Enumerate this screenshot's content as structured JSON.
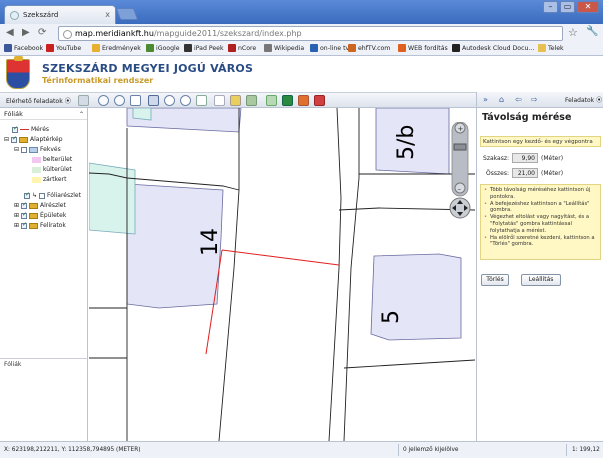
{
  "browser": {
    "tab_title": "Szekszárd",
    "tab_close": "x",
    "address_host": "map.meridiankft.hu",
    "address_path": "/mapguide2011/szekszard/index.php",
    "bookmarks": [
      {
        "label": "Facebook",
        "color": "#3b5998"
      },
      {
        "label": "YouTube",
        "color": "#cc2020"
      },
      {
        "label": "Eredmények",
        "color": "#e8b030"
      },
      {
        "label": "iGoogle",
        "color": "#4a8a30"
      },
      {
        "label": "iPad Peek",
        "color": "#333333"
      },
      {
        "label": "nCore",
        "color": "#b02020"
      },
      {
        "label": "Wikipedia",
        "color": "#777777"
      },
      {
        "label": "on-line tv",
        "color": "#2a60b0"
      },
      {
        "label": "ehfTV.com",
        "color": "#cc6620"
      },
      {
        "label": "WEB fordítás",
        "color": "#e06020"
      },
      {
        "label": "Autodesk Cloud Docu...",
        "color": "#222222"
      },
      {
        "label": "Telek",
        "color": "#e8c050"
      }
    ]
  },
  "site": {
    "title": "SZEKSZÁRD MEGYEI JOGÚ VÁROS",
    "subtitle": "Térinformatikai rendszer"
  },
  "app_toolbar": {
    "tasks_label": "Elérhető feladatok"
  },
  "left_panel": {
    "header": "Fóliák",
    "layers": [
      {
        "label": "Mérés",
        "checked": true
      },
      {
        "label": "Alaptérkép",
        "checked": true
      },
      {
        "label": "Fekvés",
        "checked": false
      },
      {
        "label": "belterület",
        "legend": "#f2c8f0"
      },
      {
        "label": "külterület",
        "legend": "#d8f0d8"
      },
      {
        "label": "zártkert",
        "legend": "#fff5b0"
      },
      {
        "label": "Fóliarészlet",
        "checked": true
      },
      {
        "label": "Alrészlet",
        "checked": true
      },
      {
        "label": "Épületek",
        "checked": true
      },
      {
        "label": "Felíratok",
        "checked": true
      }
    ],
    "footer": "Fóliák"
  },
  "map": {
    "parcel_labels": [
      "5/b",
      "14",
      "5"
    ]
  },
  "right_panel": {
    "tasks_label": "Feladatok",
    "title": "Távolság mérése",
    "hint": "Kattintson egy kezdő- és egy végpontra",
    "segment_label": "Szakasz:",
    "segment_value": "9,90",
    "segment_unit": "(Méter)",
    "total_label": "Összes:",
    "total_value": "21,00",
    "total_unit": "(Méter)",
    "tips": [
      "Több távolság méréséhez kattintson új pontokra.",
      "A befejezéshez kattintson a \"Leállítás\" gombra.",
      "Végezhet eltolást vagy nagyítást, és a \"Folytatás\" gombra kattintással folytathatja a mérést.",
      "Ha elölről szeretné kezdeni, kattintson a \"Törlés\" gombra."
    ],
    "clear_button": "Törlés",
    "stop_button": "Leállítás"
  },
  "status_bar": {
    "coords": "X: 623198,212211, Y: 112358,794895 (METER)",
    "selected": "0 jellemző kijelölve",
    "scale": "1: 199,12"
  }
}
